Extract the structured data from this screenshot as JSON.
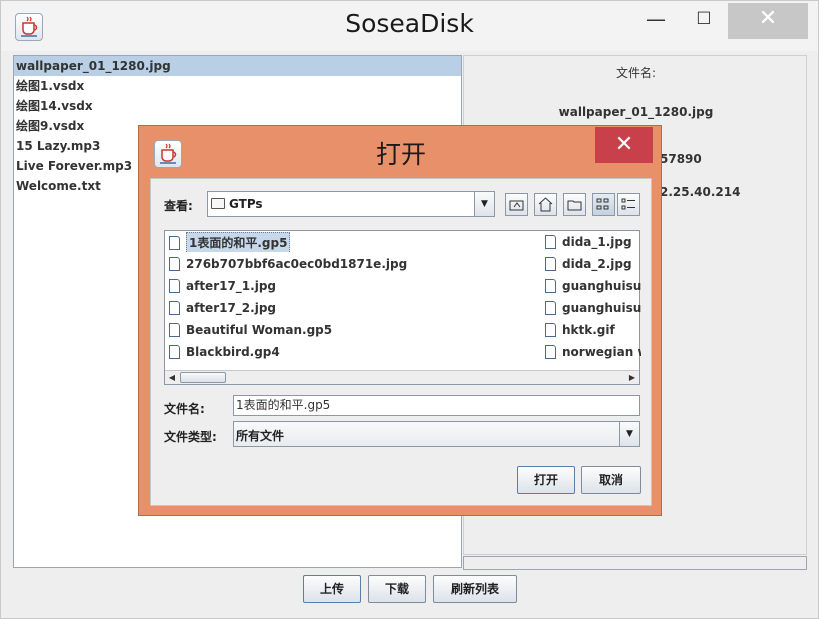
{
  "window": {
    "title": "SoseaDisk",
    "minimize_glyph": "—",
    "maximize_glyph": "☐",
    "close_glyph": "✕",
    "icon": "java-coffee-icon"
  },
  "file_list": {
    "items": [
      {
        "name": "wallpaper_01_1280.jpg",
        "selected": true
      },
      {
        "name": "绘图1.vsdx",
        "selected": false
      },
      {
        "name": "绘图14.vsdx",
        "selected": false
      },
      {
        "name": "绘图9.vsdx",
        "selected": false
      },
      {
        "name": "15 Lazy.mp3",
        "selected": false
      },
      {
        "name": "Live Forever.mp3",
        "selected": false
      },
      {
        "name": "Welcome.txt",
        "selected": false
      }
    ]
  },
  "info_panel": {
    "filename_label": "文件名:",
    "filename_value": "wallpaper_01_1280.jpg",
    "size_value_partial": "57890",
    "ip_value_partial": "2.25.40.214"
  },
  "buttons": {
    "upload": "上传",
    "download": "下载",
    "refresh": "刷新列表"
  },
  "dialog": {
    "title": "打开",
    "close_glyph": "✕",
    "look_in_label": "查看:",
    "look_in_value": "GTPs",
    "files_col1": [
      "1表面的和平.gp5",
      "276b707bbf6ac0ec0bd1871e.jpg",
      "after17_1.jpg",
      "after17_2.jpg",
      "Beautiful Woman.gp5",
      "Blackbird.gp4"
    ],
    "files_col2": [
      "dida_1.jpg",
      "dida_2.jpg",
      "guanghuisuiyu",
      "guanghuisuiyu",
      "hktk.gif",
      "norwegian wo"
    ],
    "selected_file": "1表面的和平.gp5",
    "filename_label": "文件名:",
    "filename_value": "1表面的和平.gp5",
    "filetype_label": "文件类型:",
    "filetype_value": "所有文件",
    "open_button": "打开",
    "cancel_button": "取消"
  },
  "colors": {
    "dialog_frame": "#e8906a",
    "dialog_close": "#c7404a",
    "selection": "#b8cfe5"
  }
}
